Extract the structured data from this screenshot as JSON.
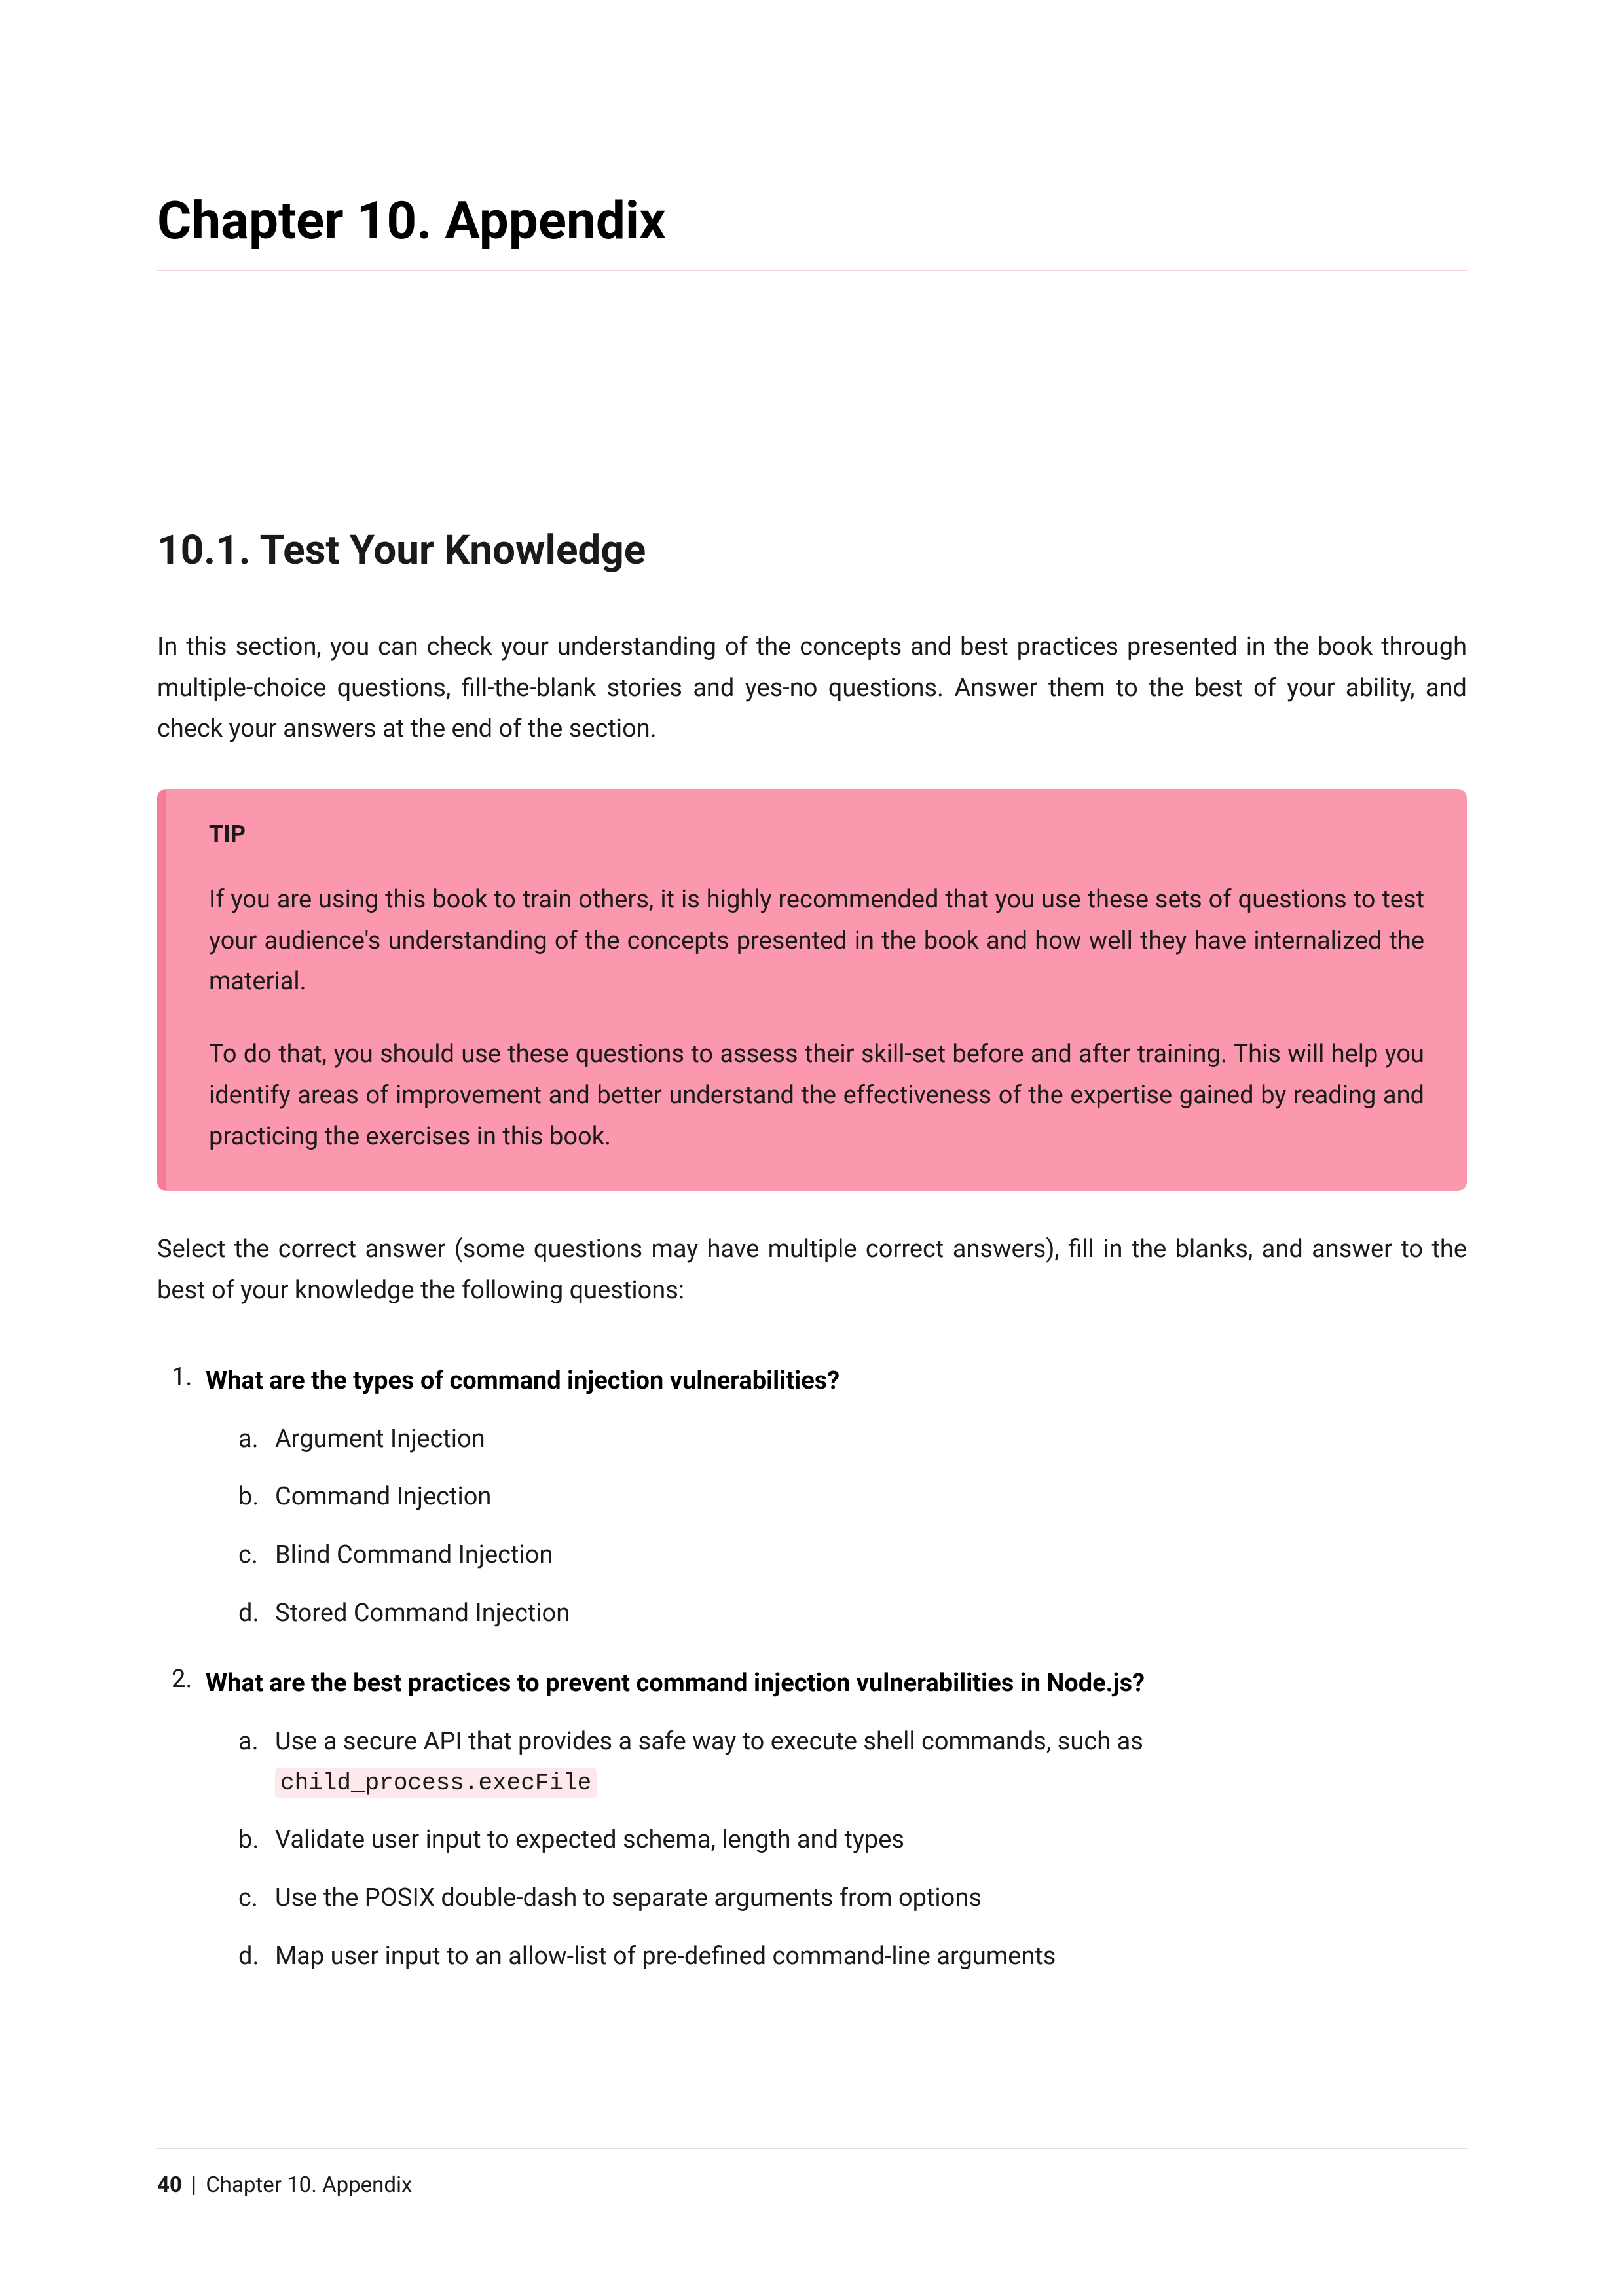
{
  "chapter": {
    "title": "Chapter 10. Appendix"
  },
  "section": {
    "title": "10.1. Test Your Knowledge",
    "intro": "In this section, you can check your understanding of the concepts and best practices presented in the book through multiple-choice questions, fill-the-blank stories and yes-no questions. Answer them to the best of your ability, and check your answers at the end of the section."
  },
  "tip": {
    "label": "TIP",
    "paragraphs": [
      "If you are using this book to train others, it is highly recommended that you use these sets of questions to test your audience's understanding of the concepts presented in the book and how well they have internalized the material.",
      "To do that, you should use these questions to assess their skill-set before and after training. This will help you identify areas of improvement and better understand the effectiveness of the expertise gained by reading and practicing the exercises in this book."
    ]
  },
  "instruction": "Select the correct answer (some questions may have multiple correct answers), fill in the blanks, and answer to the best of your knowledge the following questions:",
  "questions": [
    {
      "text": "What are the types of command injection vulnerabilities?",
      "answers": [
        "Argument Injection",
        "Command Injection",
        "Blind Command Injection",
        "Stored Command Injection"
      ]
    },
    {
      "text": "What are the best practices to prevent command injection vulnerabilities in Node.js?",
      "answers": [
        "Use a secure API that provides a safe way to execute shell commands, such as",
        "Validate user input to expected schema, length and types",
        "Use the POSIX double-dash to separate arguments from options",
        "Map user input to an allow-list of pre-defined command-line arguments"
      ],
      "code_suffix_for_answer_0": "child_process.execFile"
    }
  ],
  "footer": {
    "page": "40",
    "label": "Chapter 10. Appendix"
  }
}
